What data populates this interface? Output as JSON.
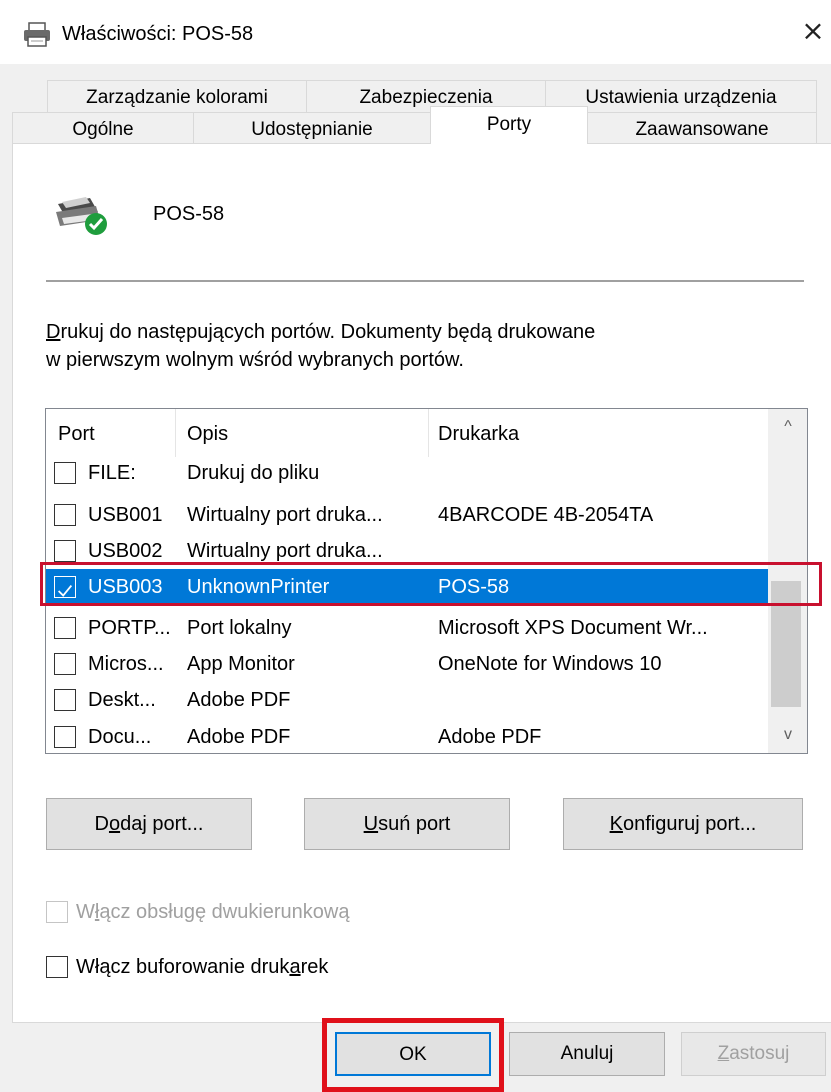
{
  "window": {
    "title": "Właściwości: POS-58",
    "close_glyph": "×"
  },
  "tabs": {
    "row1": [
      "Zarządzanie kolorami",
      "Zabezpieczenia",
      "Ustawienia urządzenia"
    ],
    "row2": [
      "Ogólne",
      "Udostępnianie",
      "Porty",
      "Zaawansowane"
    ],
    "active": "Porty"
  },
  "printer": {
    "name": "POS-58",
    "icon": "printer-ok-icon"
  },
  "description": {
    "first_letter": "D",
    "line1_rest": "rukuj do następujących portów. Dokumenty będą drukowane",
    "line2": "w pierwszym wolnym wśród wybranych portów."
  },
  "ports_table": {
    "headers": [
      "Port",
      "Opis",
      "Drukarka"
    ],
    "rows": [
      {
        "port": "FILE:",
        "desc": "Drukuj do pliku",
        "printer": "",
        "checked": false
      },
      {
        "port": "USB001",
        "desc": "Wirtualny port druka...",
        "printer": "4BARCODE 4B-2054TA",
        "checked": false
      },
      {
        "port": "USB002",
        "desc": "Wirtualny port druka...",
        "printer": "",
        "checked": false
      },
      {
        "port": "USB003",
        "desc": "UnknownPrinter",
        "printer": "POS-58",
        "checked": true,
        "selected": true
      },
      {
        "port": "PORTP...",
        "desc": "Port lokalny",
        "printer": "Microsoft XPS Document Wr...",
        "checked": false
      },
      {
        "port": "Micros...",
        "desc": "App Monitor",
        "printer": "OneNote for Windows 10",
        "checked": false
      },
      {
        "port": "Deskt...",
        "desc": "Adobe PDF",
        "printer": "",
        "checked": false
      },
      {
        "port": "Docu...",
        "desc": "Adobe PDF",
        "printer": "Adobe PDF",
        "checked": false
      }
    ],
    "scroll_up_glyph": "^",
    "scroll_down_glyph": "v"
  },
  "port_buttons": {
    "add": {
      "pre": "D",
      "u": "o",
      "post": "daj port..."
    },
    "remove": {
      "pre": "",
      "u": "U",
      "post": "suń port"
    },
    "configure": {
      "pre": "",
      "u": "K",
      "post": "onfiguruj port..."
    }
  },
  "options": {
    "bidirectional": {
      "pre": "W",
      "u": "ł",
      "post": "ącz obsługę dwukierunkową",
      "checked": false,
      "disabled": true
    },
    "pooling": {
      "pre": "Włącz buforowanie druk",
      "u": "a",
      "post": "rek",
      "checked": false,
      "disabled": false
    }
  },
  "footer": {
    "ok": "OK",
    "cancel": "Anuluj",
    "apply_u": "Z",
    "apply_rest": "astosuj"
  },
  "colors": {
    "selection": "#0078d7",
    "highlight": "#c8102e"
  }
}
